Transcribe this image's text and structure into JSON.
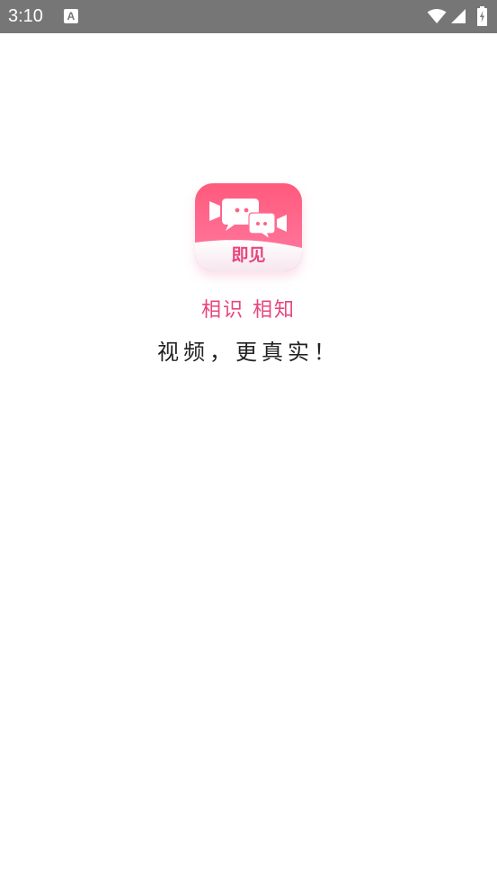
{
  "status_bar": {
    "time": "3:10",
    "notification_icon": "A",
    "icons": [
      "wifi-icon",
      "signal-icon",
      "battery-charging-icon"
    ]
  },
  "splash": {
    "logo_text": "即见",
    "slogan_primary": "相识 相知",
    "slogan_secondary": "视频，更真实！"
  },
  "colors": {
    "status_bar": "#767676",
    "brand_pink": "#e8457c",
    "logo_gradient_top": "#ff5f7e",
    "logo_gradient_bottom": "#ff7aa2"
  }
}
